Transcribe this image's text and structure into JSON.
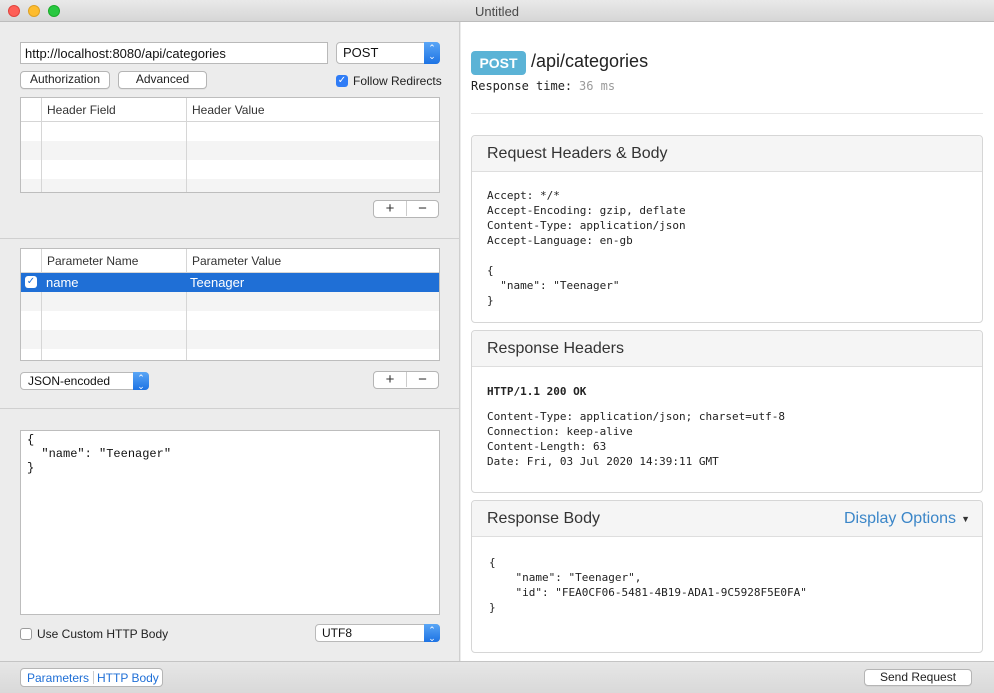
{
  "window": {
    "title": "Untitled"
  },
  "request": {
    "url": "http://localhost:8080/api/categories",
    "method": "POST",
    "authorization_label": "Authorization",
    "advanced_label": "Advanced",
    "follow_redirects_label": "Follow Redirects",
    "follow_redirects": true
  },
  "headers_table": {
    "columns": [
      "Header Field",
      "Header Value"
    ]
  },
  "params_table": {
    "columns": [
      "Parameter Name",
      "Parameter Value"
    ],
    "rows": [
      {
        "enabled": true,
        "name": "name",
        "value": "Teenager"
      }
    ]
  },
  "encoding_popup": {
    "selected": "JSON-encoded"
  },
  "body_editor": {
    "text": "{\n  \"name\": \"Teenager\"\n}"
  },
  "custom_body": {
    "label": "Use Custom HTTP Body",
    "checked": false,
    "charset": "UTF8"
  },
  "bottom_bar": {
    "tabs": [
      "Parameters",
      "HTTP Body"
    ],
    "send_label": "Send Request"
  },
  "plus_glyph": "+",
  "minus_glyph": "−",
  "response": {
    "method_badge": "POST",
    "path": "/api/categories",
    "response_time_label": "Response time:",
    "response_time_value": "36 ms",
    "request_section": {
      "title": "Request Headers & Body",
      "headers": "Accept: */*\nAccept-Encoding: gzip, deflate\nContent-Type: application/json\nAccept-Language: en-gb",
      "body": "{\n  \"name\": \"Teenager\"\n}"
    },
    "response_headers_section": {
      "title": "Response Headers",
      "status": "HTTP/1.1 200 OK",
      "headers": "Content-Type: application/json; charset=utf-8\nConnection: keep-alive\nContent-Length: 63\nDate: Fri, 03 Jul 2020 14:39:11 GMT"
    },
    "response_body_section": {
      "title": "Response Body",
      "display_options_label": "Display Options",
      "body": "{\n    \"name\": \"Teenager\",\n    \"id\": \"FEA0CF06-5481-4B19-ADA1-9C5928F5E0FA\"\n}"
    }
  },
  "colors": {
    "accent": "#1f6fd6",
    "badge": "#5bb3d6",
    "link": "#3b86c8"
  }
}
